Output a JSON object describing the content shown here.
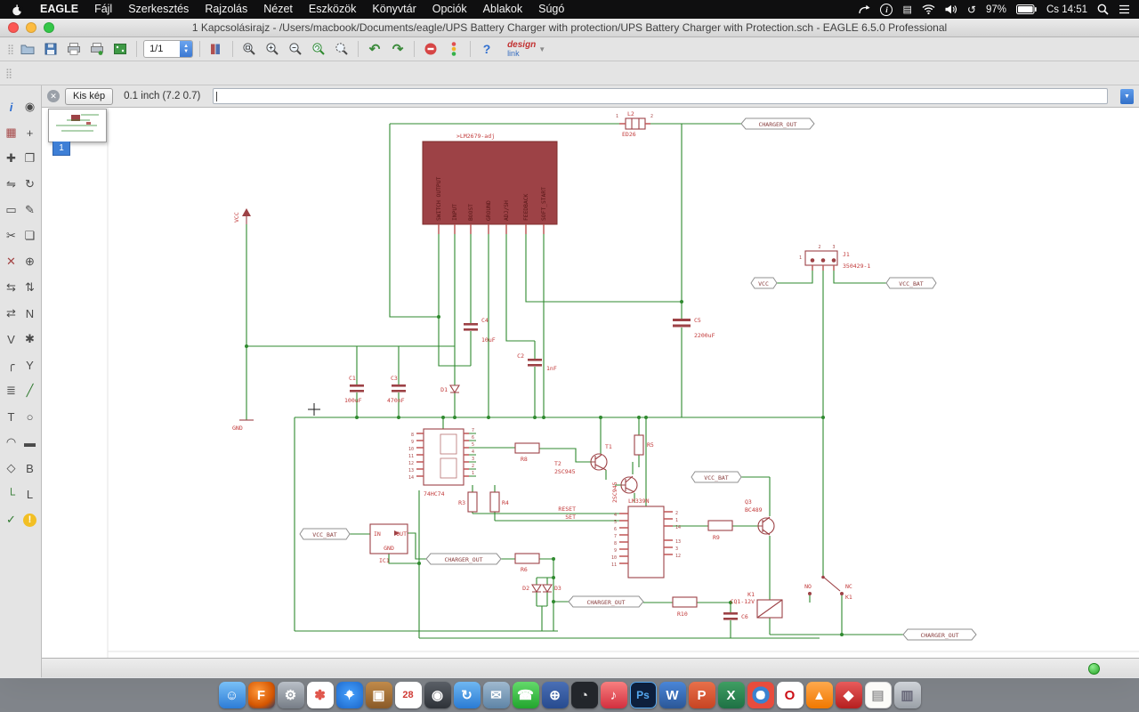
{
  "menu_bar": {
    "items": [
      "EAGLE",
      "Fájl",
      "Szerkesztés",
      "Rajzolás",
      "Nézet",
      "Eszközök",
      "Könyvtár",
      "Opciók",
      "Ablakok",
      "Súgó"
    ],
    "status": {
      "battery_percent": "97%",
      "clock": "Cs 14:51"
    }
  },
  "window": {
    "title": "1 Kapcsolásirajz - /Users/macbook/Documents/eagle/UPS Battery Charger with protection/UPS Battery Charger with Protection.sch - EAGLE 6.5.0 Professional"
  },
  "toolbar": {
    "sheet_selector": "1/1",
    "help_label": "?",
    "designlink_top": "design",
    "designlink_bottom": "link"
  },
  "command_bar": {
    "minimap_toggle": "Kis kép",
    "coordinates": "0.1 inch (7.2 0.7)",
    "command_value": ""
  },
  "sheet_tab": "1",
  "sidebar_tools": [
    {
      "name": "info",
      "glyph": "i"
    },
    {
      "name": "show",
      "glyph": "◉"
    },
    {
      "name": "display",
      "glyph": "▦"
    },
    {
      "name": "mark",
      "glyph": "+"
    },
    {
      "name": "move",
      "glyph": "✚"
    },
    {
      "name": "copy",
      "glyph": "❐"
    },
    {
      "name": "mirror",
      "glyph": "⇋"
    },
    {
      "name": "rotate",
      "glyph": "↻"
    },
    {
      "name": "group",
      "glyph": "▭"
    },
    {
      "name": "change",
      "glyph": "✎"
    },
    {
      "name": "cut",
      "glyph": "✂"
    },
    {
      "name": "paste",
      "glyph": "❏"
    },
    {
      "name": "delete",
      "glyph": "✕"
    },
    {
      "name": "add",
      "glyph": "⊕"
    },
    {
      "name": "pinswap",
      "glyph": "⇆"
    },
    {
      "name": "gateswap",
      "glyph": "⇅"
    },
    {
      "name": "replace",
      "glyph": "⇄"
    },
    {
      "name": "name",
      "glyph": "N"
    },
    {
      "name": "value",
      "glyph": "V"
    },
    {
      "name": "smash",
      "glyph": "✱"
    },
    {
      "name": "miter",
      "glyph": "╭"
    },
    {
      "name": "split",
      "glyph": "Y"
    },
    {
      "name": "invoke",
      "glyph": "≣"
    },
    {
      "name": "wire",
      "glyph": "╱"
    },
    {
      "name": "text",
      "glyph": "T"
    },
    {
      "name": "circle",
      "glyph": "○"
    },
    {
      "name": "arc",
      "glyph": "◠"
    },
    {
      "name": "rect",
      "glyph": "▬"
    },
    {
      "name": "polygon",
      "glyph": "◇"
    },
    {
      "name": "bus",
      "glyph": "B"
    },
    {
      "name": "net",
      "glyph": "└"
    },
    {
      "name": "label",
      "glyph": "L"
    },
    {
      "name": "erc",
      "glyph": "✓"
    },
    {
      "name": "errors",
      "glyph": "!"
    }
  ],
  "schematic": {
    "regulator": {
      "name": ">LM2679-adj",
      "pins": [
        "SWITCH OUTPUT",
        "INPUT",
        "BOOST",
        "GROUND",
        "ADJ/SH",
        "FEEDBACK",
        "SOFT_START"
      ]
    },
    "power": {
      "vcc": "VCC",
      "gnd": "GND"
    },
    "flags": {
      "charger_out": "CHARGER_OUT",
      "vcc": "VCC",
      "vcc_bat": "VCC_BAT"
    },
    "l2": {
      "ref": "L2",
      "value": "ED26",
      "pin1": "1",
      "pin2": "2"
    },
    "caps": {
      "c1": {
        "ref": "C1",
        "value": "100uF"
      },
      "c2": {
        "ref": "C2",
        "value": "1nF"
      },
      "c3": {
        "ref": "C3",
        "value": "470nF"
      },
      "c4": {
        "ref": "C4",
        "value": "10uF"
      },
      "c5": {
        "ref": "C5",
        "value": "2200uF"
      },
      "c6": {
        "ref": "C6"
      }
    },
    "diodes": {
      "d1": "D1",
      "d2": "D2",
      "d3": "D3"
    },
    "resistors": {
      "r3": "R3",
      "r4": "R4",
      "r5": "R5",
      "r6": "R6",
      "r8": "R8",
      "r9": "R9",
      "r10": "R10"
    },
    "ff": {
      "name": "74HC74",
      "left_pins": [
        "8",
        "9",
        "10",
        "11",
        "12",
        "13",
        "14"
      ],
      "right_pins": [
        "7",
        "6",
        "5",
        "4",
        "3",
        "2",
        "1"
      ]
    },
    "comparator": {
      "name": "LM339N",
      "left_pins": [
        "4",
        "5",
        "6",
        "7",
        "8",
        "9",
        "10",
        "11"
      ],
      "right_pins": [
        "2",
        "1",
        "14",
        "13",
        "3",
        "12"
      ]
    },
    "labels": {
      "reset": "RESET",
      "set": "SET"
    },
    "transistors": {
      "t1": {
        "ref": "T1",
        "value": "2SC945"
      },
      "t2": {
        "ref": "T2",
        "value": "2SC945"
      },
      "q3": {
        "ref": "Q3",
        "value": "BC489"
      }
    },
    "ic1": {
      "ref": "IC1",
      "pin_in": "IN",
      "pin_out": "OUT",
      "pin_gnd": "GND"
    },
    "j1": {
      "ref": "J1",
      "value": "350429-1",
      "pin1": "1",
      "pin2": "2",
      "pin3": "3"
    },
    "relay": {
      "ref": "K1",
      "value": "CQ1-12V",
      "no": "NO",
      "nc": "NC",
      "ref2": "K1"
    }
  },
  "dock_items": [
    {
      "name": "finder",
      "glyph": "☺"
    },
    {
      "name": "firefox",
      "glyph": "F"
    },
    {
      "name": "system-preferences",
      "glyph": "⚙"
    },
    {
      "name": "photos",
      "glyph": "✽"
    },
    {
      "name": "safari",
      "glyph": "✦"
    },
    {
      "name": "file-archive",
      "glyph": "▣"
    },
    {
      "name": "calendar",
      "glyph": "28"
    },
    {
      "name": "camera",
      "glyph": "◉"
    },
    {
      "name": "app-store",
      "glyph": "↻"
    },
    {
      "name": "mail",
      "glyph": "✉"
    },
    {
      "name": "facetime",
      "glyph": "☎"
    },
    {
      "name": "network",
      "glyph": "⊕"
    },
    {
      "name": "terminal",
      "glyph": "◔"
    },
    {
      "name": "itunes",
      "glyph": "♪"
    },
    {
      "name": "photoshop",
      "glyph": "Ps"
    },
    {
      "name": "word",
      "glyph": "W"
    },
    {
      "name": "powerpoint",
      "glyph": "P"
    },
    {
      "name": "excel",
      "glyph": "X"
    },
    {
      "name": "chrome",
      "glyph": "C"
    },
    {
      "name": "opera",
      "glyph": "O"
    },
    {
      "name": "vlc",
      "glyph": "▲"
    },
    {
      "name": "installer",
      "glyph": "◆"
    },
    {
      "name": "textedit",
      "glyph": "▤"
    },
    {
      "name": "trash",
      "glyph": "▥"
    }
  ],
  "colors": {
    "wire_green": "#2f8a2f",
    "component_red": "#9d4246",
    "selection_blue": "#3e7fd6"
  }
}
